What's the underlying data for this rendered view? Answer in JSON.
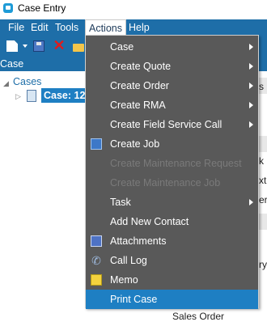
{
  "window": {
    "title": "Case Entry",
    "icon": "app-icon"
  },
  "menubar": {
    "items": [
      "File",
      "Edit",
      "Tools",
      "Actions",
      "Help"
    ],
    "open_item": "Actions"
  },
  "toolbar": {
    "icons": [
      "new-document-icon",
      "dropdown-arrow-icon",
      "save-icon",
      "delete-icon",
      "folder-icon"
    ]
  },
  "panel": {
    "header": "Case"
  },
  "tree": {
    "root_label": "Cases",
    "selected_label": "Case: 12"
  },
  "right_fragments": [
    "s",
    "k",
    "xt",
    "er",
    "ry"
  ],
  "footer": {
    "sales_order": "Sales Order"
  },
  "actions_menu": {
    "items": [
      {
        "label": "Case",
        "submenu": true,
        "enabled": true
      },
      {
        "label": "Create Quote",
        "submenu": true,
        "enabled": true
      },
      {
        "label": "Create Order",
        "submenu": true,
        "enabled": true
      },
      {
        "label": "Create RMA",
        "submenu": true,
        "enabled": true
      },
      {
        "label": "Create Field Service Call",
        "submenu": true,
        "enabled": true
      },
      {
        "label": "Create Job",
        "submenu": false,
        "enabled": true,
        "icon": "job-icon"
      },
      {
        "label": "Create Maintenance Request",
        "submenu": false,
        "enabled": false
      },
      {
        "label": "Create Maintenance Job",
        "submenu": false,
        "enabled": false
      },
      {
        "label": "Task",
        "submenu": true,
        "enabled": true
      },
      {
        "label": "Add New Contact",
        "submenu": false,
        "enabled": true
      },
      {
        "label": "Attachments",
        "submenu": false,
        "enabled": true,
        "icon": "attachments-icon"
      },
      {
        "label": "Call Log",
        "submenu": false,
        "enabled": true,
        "icon": "call-log-icon"
      },
      {
        "label": "Memo",
        "submenu": false,
        "enabled": true,
        "icon": "memo-icon"
      },
      {
        "label": "Print Case",
        "submenu": false,
        "enabled": true,
        "highlighted": true
      }
    ]
  },
  "colors": {
    "menubar_bg": "#1e6ea8",
    "menu_bg": "#595959",
    "highlight": "#1e7fc3",
    "disabled_text": "#7a7a7a"
  }
}
